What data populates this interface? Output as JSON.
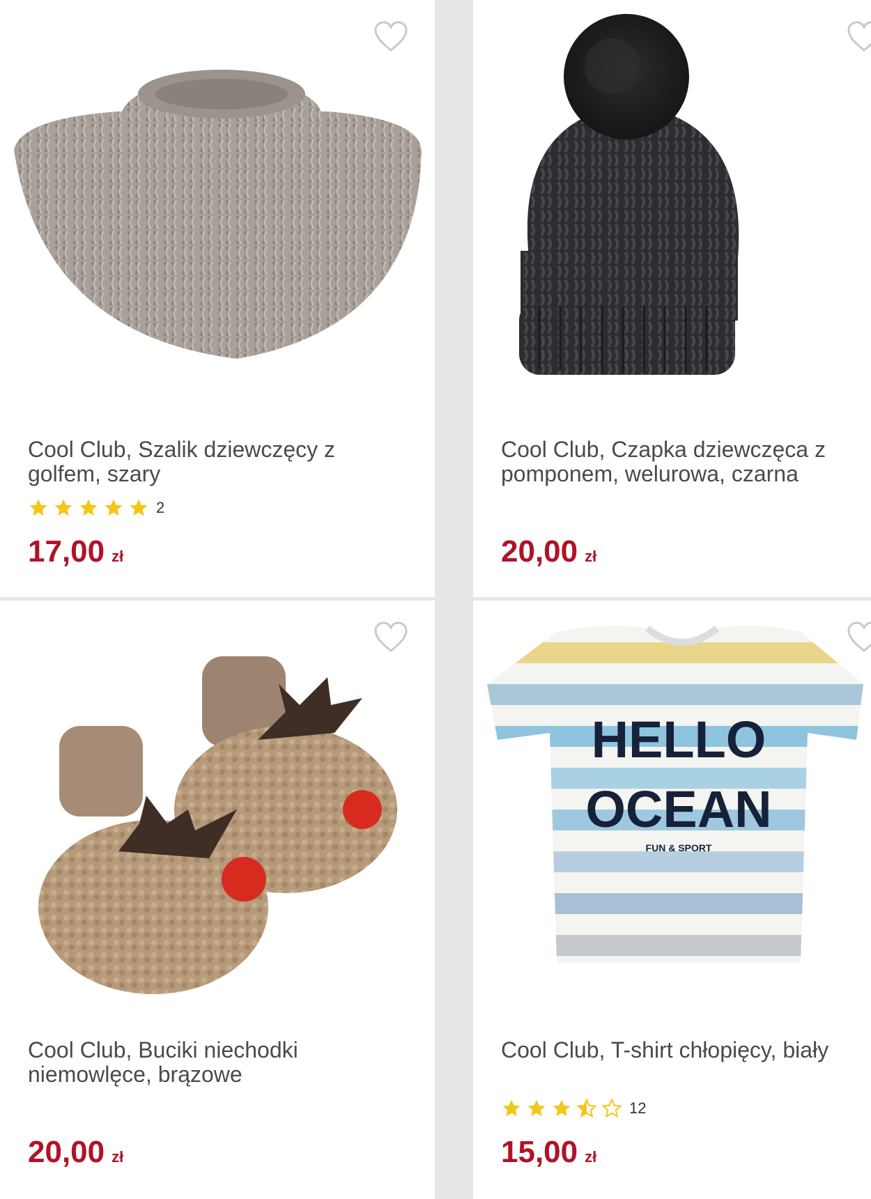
{
  "products": [
    {
      "title": "Cool Club, Szalik dziewczęcy z golfem, szary",
      "rating_stars": 5,
      "rating_count": "2",
      "price": "17,00",
      "currency": "zł",
      "image_icon": "knit-neck-warmer-image"
    },
    {
      "title": "Cool Club, Czapka dziewczęca z pomponem, welurowa, czarna",
      "price": "20,00",
      "currency": "zł",
      "image_icon": "pompom-hat-image"
    },
    {
      "title": "Cool Club, Buciki niechodki niemowlęce, brązowe",
      "price": "20,00",
      "currency": "zł",
      "image_icon": "reindeer-booties-image"
    },
    {
      "title": "Cool Club, T-shirt chłopięcy, biały",
      "rating_stars": 3.5,
      "rating_count": "12",
      "price": "15,00",
      "currency": "zł",
      "image_icon": "striped-tshirt-image",
      "image_text_1": "HELLO",
      "image_text_2": "OCEAN",
      "image_text_3": "FUN & SPORT"
    }
  ],
  "colors": {
    "price": "#b01327",
    "star": "#f5c518",
    "background": "#e6e6e6"
  }
}
